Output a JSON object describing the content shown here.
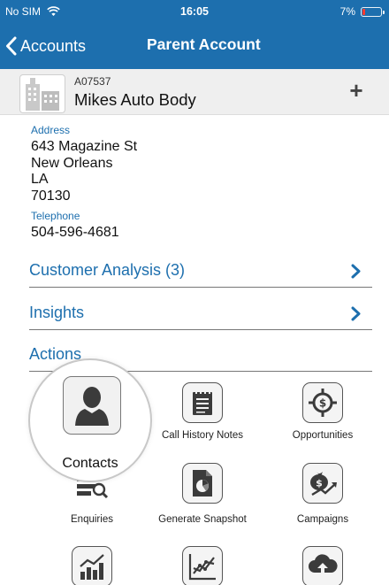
{
  "status_bar": {
    "carrier": "No SIM",
    "time": "16:05",
    "battery": "7%"
  },
  "nav": {
    "back_label": "Accounts",
    "title": "Parent Account"
  },
  "account": {
    "code": "A07537",
    "name": "Mikes Auto Body",
    "add_label": "+"
  },
  "details": {
    "address_label": "Address",
    "address_lines": [
      "643 Magazine St",
      "New Orleans",
      "LA",
      "70130"
    ],
    "telephone_label": "Telephone",
    "telephone": "504-596-4681"
  },
  "sections": {
    "customer_analysis": "Customer Analysis (3)",
    "insights": "Insights",
    "actions": "Actions"
  },
  "actions": [
    {
      "label": "Contacts",
      "icon": "person-icon"
    },
    {
      "label": "Call History Notes",
      "icon": "notepad-icon"
    },
    {
      "label": "Opportunities",
      "icon": "target-dollar-icon"
    },
    {
      "label": "Enquiries",
      "icon": "search-list-icon"
    },
    {
      "label": "Generate Snapshot",
      "icon": "pie-document-icon"
    },
    {
      "label": "Campaigns",
      "icon": "money-growth-icon"
    },
    {
      "label": "",
      "icon": "bar-chart-icon"
    },
    {
      "label": "",
      "icon": "line-chart-icon"
    },
    {
      "label": "",
      "icon": "cloud-upload-icon"
    }
  ],
  "colors": {
    "brand_blue": "#1d6fae",
    "battery_low": "#ff3b30"
  }
}
